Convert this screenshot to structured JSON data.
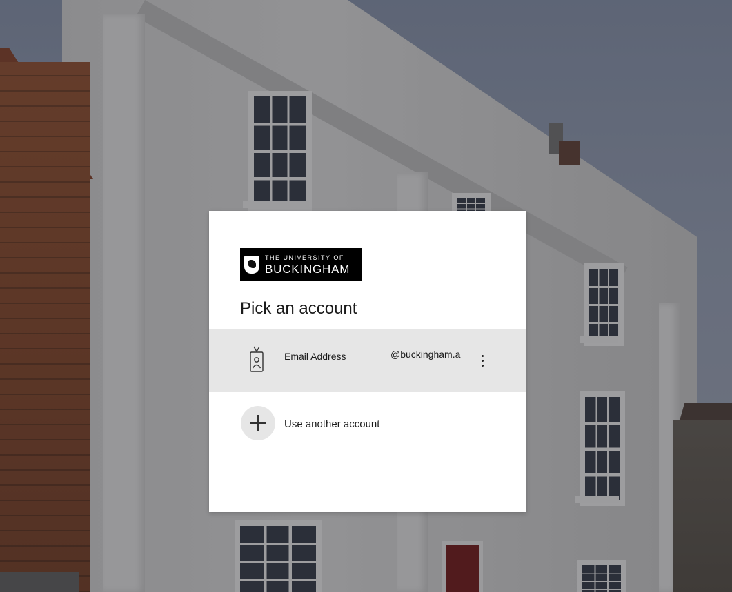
{
  "brand": {
    "line1": "THE UNIVERSITY OF",
    "line2": "BUCKINGHAM"
  },
  "title": "Pick an account",
  "account": {
    "label": "Email Address",
    "email": "@buckingham.a",
    "icon": "badge-icon",
    "more_icon": "more-options-icon"
  },
  "another": {
    "label": "Use another account",
    "icon": "plus-icon"
  },
  "colors": {
    "row_highlight": "#e6e6e6",
    "dialog_bg": "#ffffff",
    "logo_bg": "#000000"
  }
}
